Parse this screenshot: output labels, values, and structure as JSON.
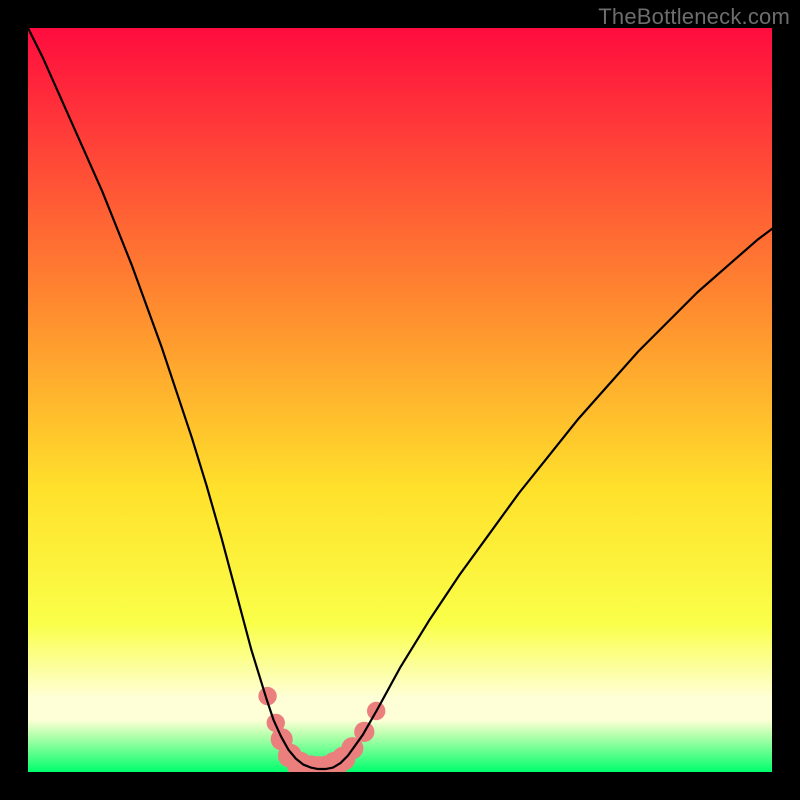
{
  "watermark": "TheBottleneck.com",
  "chart_data": {
    "type": "line",
    "title": "",
    "xlabel": "",
    "ylabel": "",
    "xlim": [
      0,
      100
    ],
    "ylim": [
      0,
      100
    ],
    "x": [
      0,
      2,
      4,
      6,
      8,
      10,
      12,
      14,
      16,
      18,
      20,
      22,
      24,
      26,
      28,
      30,
      32,
      33,
      34,
      35,
      36,
      37,
      38,
      39,
      40,
      41,
      42,
      43,
      45,
      47,
      50,
      54,
      58,
      62,
      66,
      70,
      74,
      78,
      82,
      86,
      90,
      94,
      98,
      100
    ],
    "y": [
      100,
      96,
      91.5,
      87,
      82.5,
      78,
      73,
      68,
      62.5,
      57,
      51,
      45,
      38.5,
      31.5,
      24,
      16.5,
      10,
      7,
      4.8,
      3,
      1.8,
      1,
      0.6,
      0.4,
      0.4,
      0.6,
      1.2,
      2.2,
      5,
      8.5,
      14,
      20.5,
      26.5,
      32,
      37.5,
      42.5,
      47.5,
      52,
      56.5,
      60.5,
      64.5,
      68,
      71.5,
      73
    ],
    "markers": {
      "color": "#ea7f7d",
      "points": [
        {
          "x": 32.2,
          "y": 10.2,
          "r": 2.0
        },
        {
          "x": 33.3,
          "y": 6.6,
          "r": 2.0
        },
        {
          "x": 34.1,
          "y": 4.4,
          "r": 2.4
        },
        {
          "x": 35.2,
          "y": 2.2,
          "r": 2.6
        },
        {
          "x": 36.5,
          "y": 1.0,
          "r": 2.8
        },
        {
          "x": 38.0,
          "y": 0.5,
          "r": 2.8
        },
        {
          "x": 39.0,
          "y": 0.4,
          "r": 2.8
        },
        {
          "x": 40.2,
          "y": 0.5,
          "r": 2.8
        },
        {
          "x": 41.3,
          "y": 1.0,
          "r": 2.8
        },
        {
          "x": 42.4,
          "y": 1.8,
          "r": 2.6
        },
        {
          "x": 43.6,
          "y": 3.2,
          "r": 2.4
        },
        {
          "x": 45.2,
          "y": 5.4,
          "r": 2.2
        },
        {
          "x": 46.8,
          "y": 8.2,
          "r": 2.0
        }
      ]
    },
    "gradient_colors": {
      "top": "#ff0c3e",
      "mid1": "#ff8d2f",
      "mid2": "#ffe12b",
      "mid3": "#faff49",
      "band": "#feffd6",
      "green": "#00ff6c"
    },
    "curve_color": "#000000"
  }
}
